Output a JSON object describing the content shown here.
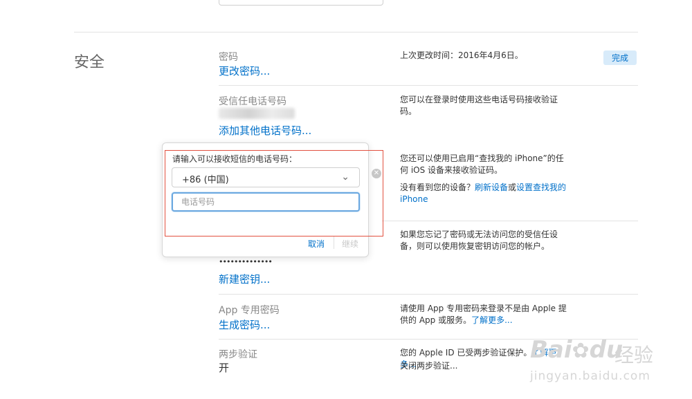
{
  "security": {
    "section_title": "安全",
    "done_label": "完成",
    "password": {
      "label": "密码",
      "action": "更改密码...",
      "info": "上次更改时间：2016年4月6日。"
    },
    "trusted_phone": {
      "label": "受信任电话号码",
      "action": "添加其他电话号码...",
      "info": "您可以在登录时使用这些电话号码接收验证码。"
    },
    "trusted_devices": {
      "info": "您还可以使用已启用“查找我的 iPhone”的任何 iOS 设备来接收验证码。",
      "missing_prefix": "没有看到您的设备？",
      "refresh_link": "刷新设备",
      "or": "或",
      "setup_link": "设置查找我的 iPhone"
    },
    "recovery_key": {
      "masked_value": "••••••••••••••",
      "action": "新建密钥...",
      "info": "如果您忘记了密码或无法访问您的受信任设备，则可以使用恢复密钥访问您的帐户。"
    },
    "app_password": {
      "label": "App 专用密码",
      "action": "生成密码...",
      "info": "请使用 App 专用密码来登录不是由 Apple 提供的 App 或服务。",
      "learn_more": "了解更多..."
    },
    "two_step": {
      "label": "两步验证",
      "value": "开",
      "info": "您的 Apple ID 已受两步验证保护。",
      "learn_more": "了解更多...",
      "disable_link": "关闭两步验证..."
    }
  },
  "popover": {
    "title": "请输入可以接收短信的电话号码：",
    "country_value": "+86 (中国)",
    "phone_placeholder": "电话号码",
    "phone_value": "",
    "cancel_label": "取消",
    "continue_label": "继续"
  },
  "watermark": {
    "brand": "Bai",
    "brand_suffix": "du",
    "service": "经验",
    "domain": "jingyan.baidu.com"
  },
  "colors": {
    "link": "#0070c9",
    "highlight_border": "#e2503f",
    "done_bg": "#d8ebfa"
  },
  "icons": [
    "chevron-down-icon",
    "clear-icon",
    "baidu-paw-icon"
  ]
}
